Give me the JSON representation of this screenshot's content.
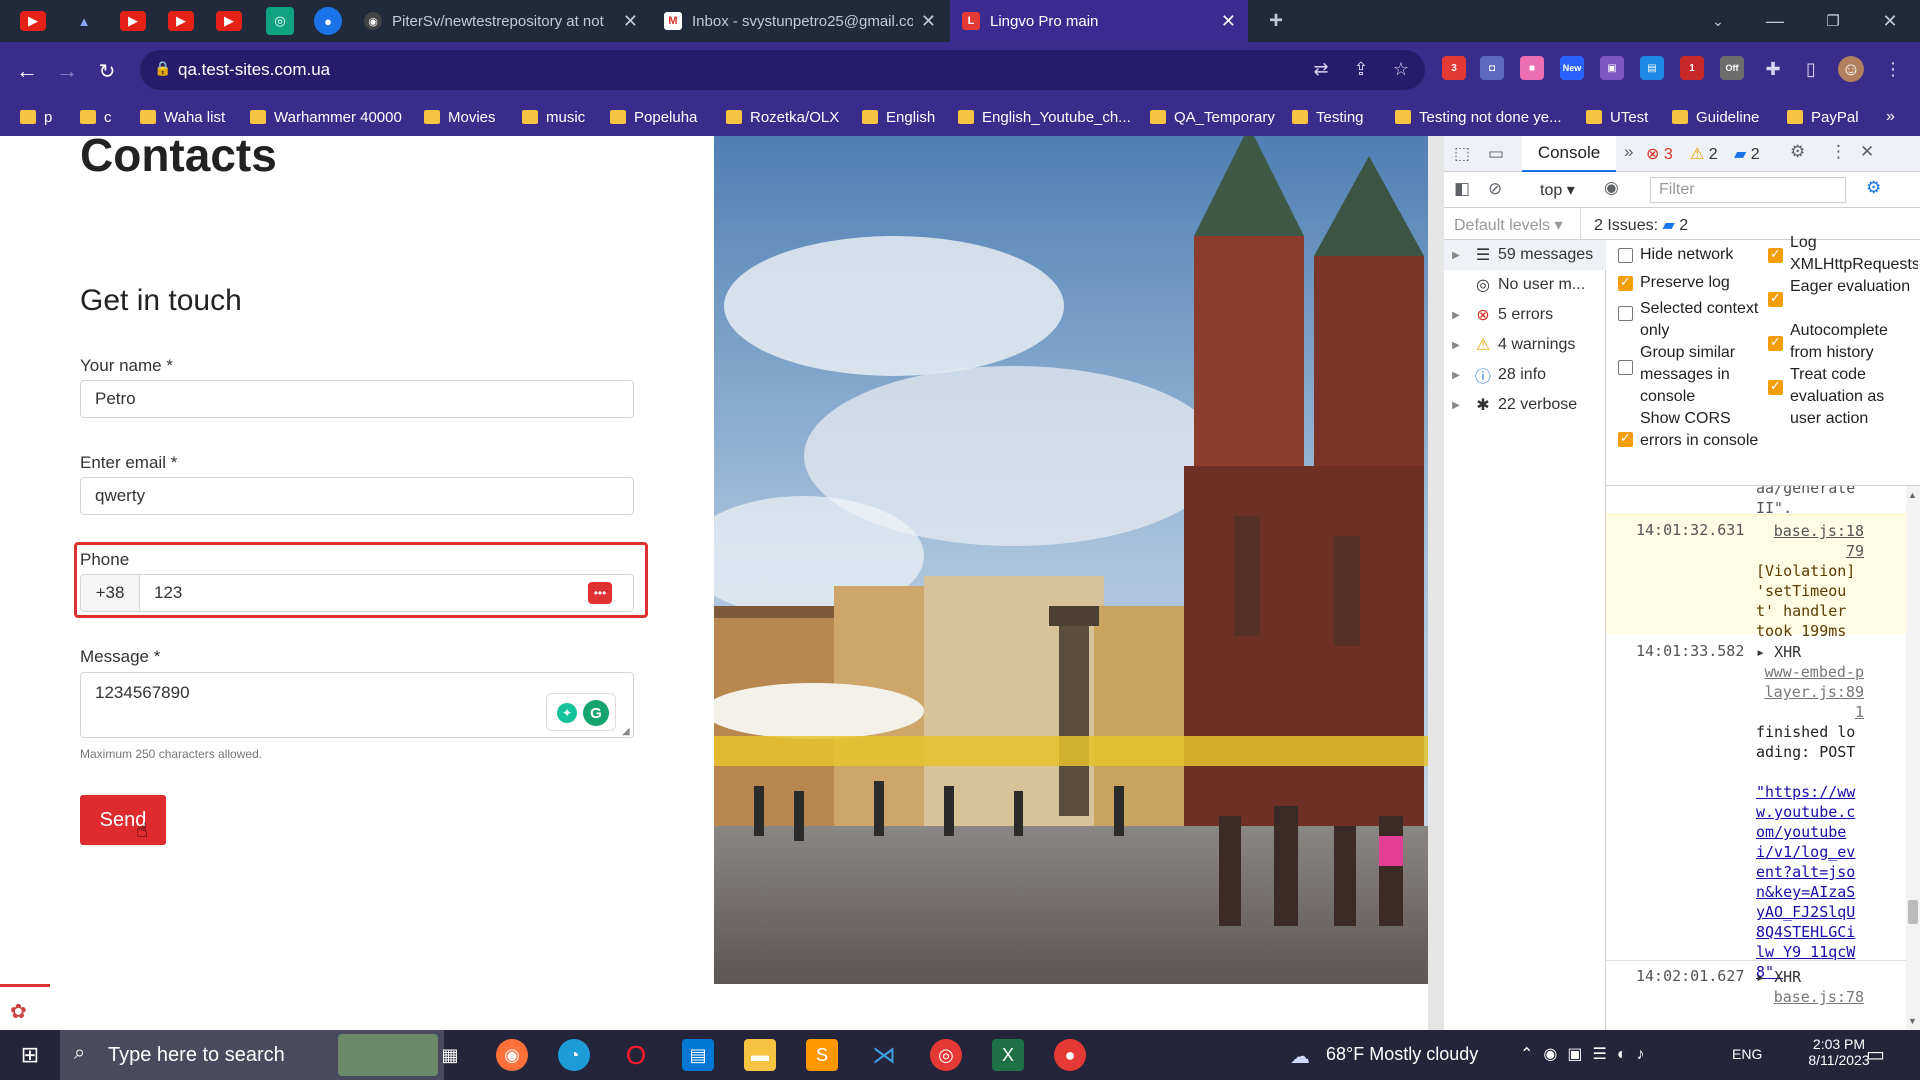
{
  "browser": {
    "tabs": [
      {
        "title": "PiterSv/newtestrepository at not",
        "active": false
      },
      {
        "title": "Inbox - svystunpetro25@gmail.co",
        "active": false
      },
      {
        "title": "Lingvo Pro main",
        "active": true
      }
    ],
    "url": "qa.test-sites.com.ua",
    "bookmarks": [
      "p",
      "c",
      "Waha list",
      "Warhammer 40000",
      "Movies",
      "music",
      "Popeluha",
      "Rozetka/OLX",
      "English",
      "English_Youtube_ch...",
      "QA_Temporary",
      "Testing",
      "Testing not done ye...",
      "UTest",
      "Guideline",
      "PayPal"
    ],
    "ext_badges": {
      "ext1": "3",
      "ext3": "New",
      "ext6": "1",
      "ext7": "Off"
    }
  },
  "page": {
    "title": "Contacts",
    "subtitle": "Get in touch",
    "name_label": "Your name *",
    "name_value": "Petro",
    "email_label": "Enter email *",
    "email_value": "qwerty",
    "phone_label": "Phone",
    "phone_prefix": "+38",
    "phone_value": "123",
    "message_label": "Message *",
    "message_value": "1234567890",
    "hint": "Maximum 250 characters allowed.",
    "send_label": "Send"
  },
  "devtools": {
    "tab_console": "Console",
    "error_count": "3",
    "warning_count": "2",
    "info_count": "2",
    "context": "top",
    "filter_placeholder": "Filter",
    "default_levels": "Default levels",
    "issues_label": "2 Issues:",
    "issues_count": "2",
    "sidebar": [
      {
        "label": "59 messages",
        "icon": "list-icon",
        "color": "#333"
      },
      {
        "label": "No user m...",
        "icon": "user-icon",
        "color": "#333"
      },
      {
        "label": "5 errors",
        "icon": "error-icon",
        "color": "#d93025"
      },
      {
        "label": "4 warnings",
        "icon": "warning-icon",
        "color": "#e8a400"
      },
      {
        "label": "28 info",
        "icon": "info-icon",
        "color": "#1a73e8"
      },
      {
        "label": "22 verbose",
        "icon": "bug-icon",
        "color": "#555"
      }
    ],
    "settings_left": [
      {
        "label": "Hide network",
        "checked": false
      },
      {
        "label": "Preserve log",
        "checked": true
      },
      {
        "label": "Selected context only",
        "checked": false
      },
      {
        "label": "Group similar messages in console",
        "checked": false
      },
      {
        "label": "Show CORS errors in console",
        "checked": true
      }
    ],
    "settings_right": [
      {
        "label": "Log XMLHttpRequests",
        "checked": true
      },
      {
        "label": "Eager evaluation",
        "checked": true
      },
      {
        "label": "Autocomplete from history",
        "checked": true
      },
      {
        "label": "Treat code evaluation as user action",
        "checked": true
      }
    ],
    "log": {
      "top_fragment": "aa/generate II\".",
      "entry1_time": "14:01:32.631",
      "entry1_source": "base.js:18 79",
      "entry1_text": "[Violation] 'setTimeout' handler took 199ms",
      "entry2_time": "14:01:33.582",
      "entry2_tag": "XHR",
      "entry2_source": "www-embed-player.js:891",
      "entry2_text": "finished loading: POST",
      "entry2_url": "\"https://www.youtube.com/youtubei/v1/log_event?alt=json&key=AIzaSyAO_FJ2SlqU8Q4STEHLGCilw_Y9_11qcW8\".",
      "entry3_time": "14:02:01.627",
      "entry3_tag": "XHR",
      "entry3_source": "base.js:78"
    }
  },
  "taskbar": {
    "search_placeholder": "Type here to search",
    "weather": "68°F  Mostly cloudy",
    "lang": "ENG",
    "time": "2:03 PM",
    "date": "8/11/2023"
  }
}
